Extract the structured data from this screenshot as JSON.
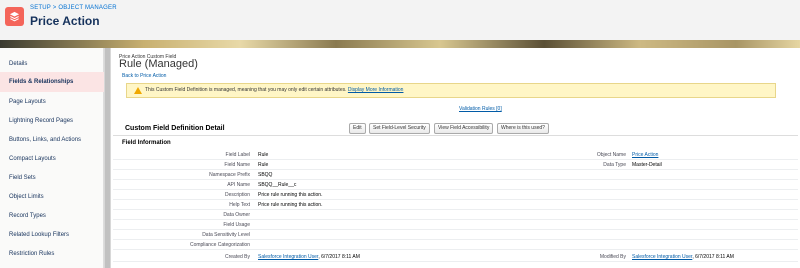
{
  "header": {
    "breadcrumb_setup": "SETUP",
    "breadcrumb_sep": " > ",
    "breadcrumb_object_manager": "OBJECT MANAGER",
    "title": "Price Action",
    "icon": "layers-icon"
  },
  "sidebar": {
    "items": [
      {
        "label": "Details"
      },
      {
        "label": "Fields & Relationships"
      },
      {
        "label": "Page Layouts"
      },
      {
        "label": "Lightning Record Pages"
      },
      {
        "label": "Buttons, Links, and Actions"
      },
      {
        "label": "Compact Layouts"
      },
      {
        "label": "Field Sets"
      },
      {
        "label": "Object Limits"
      },
      {
        "label": "Record Types"
      },
      {
        "label": "Related Lookup Filters"
      },
      {
        "label": "Restriction Rules"
      }
    ],
    "active_index": 1
  },
  "main": {
    "object_subtitle": "Price Action Custom Field",
    "field_title": "Rule (Managed)",
    "back_link": "Back to Price Action",
    "info_message": "This Custom Field Definition is managed, meaning that you may only edit certain attributes.",
    "info_link": "Display More Information",
    "validation_link": "Validation Rules [0]",
    "detail_title": "Custom Field Definition Detail",
    "buttons": {
      "edit": "Edit",
      "set_fls": "Set Field-Level Security",
      "view_access": "View Field Accessibility",
      "where_used": "Where is this used?"
    },
    "section_title": "Field Information",
    "fields": {
      "field_label": {
        "label": "Field Label",
        "value": "Rule"
      },
      "field_name": {
        "label": "Field Name",
        "value": "Rule"
      },
      "namespace_prefix": {
        "label": "Namespace Prefix",
        "value": "SBQQ"
      },
      "api_name": {
        "label": "API Name",
        "value": "SBQQ__Rule__c"
      },
      "description": {
        "label": "Description",
        "value": "Price rule running this action."
      },
      "help_text": {
        "label": "Help Text",
        "value": "Price rule running this action."
      },
      "data_owner": {
        "label": "Data Owner",
        "value": ""
      },
      "field_usage": {
        "label": "Field Usage",
        "value": ""
      },
      "data_sensitivity": {
        "label": "Data Sensitivity Level",
        "value": ""
      },
      "compliance": {
        "label": "Compliance Categorization",
        "value": ""
      },
      "created_by": {
        "label": "Created By",
        "user": "Salesforce Integration User",
        "date": ", 6/7/2017 8:11 AM"
      },
      "object_name": {
        "label": "Object Name",
        "value": "Price Action"
      },
      "data_type": {
        "label": "Data Type",
        "value": "Master-Detail"
      },
      "modified_by": {
        "label": "Modified By",
        "user": "Salesforce Integration User",
        "date": ", 6/7/2017 8:11 AM"
      }
    }
  }
}
